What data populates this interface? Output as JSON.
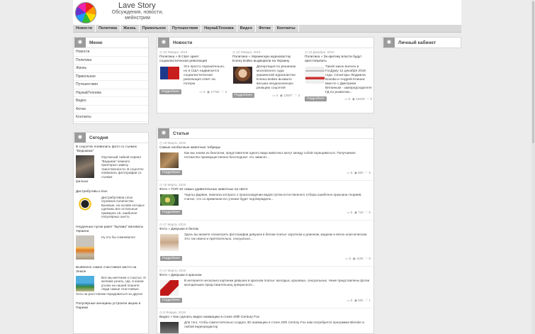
{
  "site": {
    "title": "Lave Story",
    "subtitle": "Обсуждения, новости, мейнстрим"
  },
  "nav": [
    "Новости",
    "Политика",
    "Жизнь",
    "Прикольное",
    "Путешествия",
    "Наука&Техника",
    "Видео",
    "Фотки",
    "Контакты"
  ],
  "menu": {
    "title": "Меню",
    "items": [
      "Новости",
      "Политика",
      "Жизнь",
      "Прикольное",
      "Путешествия",
      "Наука&Техника",
      "Видео",
      "Фотки",
      "Контакты"
    ]
  },
  "today": {
    "title": "Сегодня",
    "items": [
      {
        "title": "В соцсетях появились фото со съемок \"Ведьмака\"",
        "text": "Окутанный тайной сериал \"Ведьмак\" немного приоткрыл завесу таинственности. В соцсетях появились фотографии со съемок",
        "tail": "фильма"
      },
      {
        "title": "Дистрибутивы Linux",
        "text": "Дистрибутивов Linux огромное количество. Базовые, на основе которых сделаны все остальные примерно 15, наиболее популярных шесть",
        "tail": ""
      },
      {
        "title": "Неудачные пуски ракет \"Булава\" виноваты Украина",
        "text": "Ну кто бы сомневался",
        "tail": ""
      },
      {
        "title": "Выявлено самое счастливое место на Земле",
        "text": "Все мы мечтаем о счастье. И желаем узнать, где, в каком уголке на нашей планете люди самые счастливые.",
        "tail": "Хоть на расстоянии порадоваться за других"
      },
      {
        "title": "Популярные женщины устроили акцию в Париже",
        "text": "",
        "tail": ""
      }
    ]
  },
  "news": {
    "title": "Новости",
    "items": [
      {
        "date": "23 Января, 2019",
        "title": "Политика » В США зреет социалистическая революция",
        "text": "Это просто поразительно, но в США надвигается социалистическая революция ответ на потерю",
        "button": "Подробнее",
        "comments": "3",
        "views": "17752",
        "likes": "3"
      },
      {
        "date": "10 Января, 2019",
        "title": "Политика » Украинскую журналистку Елену Бойко выдворили на Украину",
        "text": "Депортация по решению московского суда украинской журналистки Елены Бойко вызвало весьма неоднозначную реакцию соцсетей",
        "button": "Подробнее",
        "comments": "4",
        "views": "12807",
        "likes": "3"
      },
      {
        "date": "24 Декабря, 2018",
        "title": "Политика » За критику власти будут арестовывать",
        "text": "Такой закон внесен в ГосДуму 12 декабря 2018 года. Сенаторы Людмила Бокова и Андрей Клишас вместе с Дмитрием Вяткиным - зампредседателя ГД по развитию...",
        "button": "Подробнее",
        "comments": "5",
        "views": "15429",
        "likes": "0"
      }
    ]
  },
  "articles": {
    "title": "Статьи",
    "items": [
      {
        "date": "19 Марта, 2019",
        "title": "Самые необычные животные тибреды",
        "text": "Как мы знаем из биологии, представители одного вида животных могут между собой скрещиваться. Получаемое потомство преимущественно бесплодное: это зависит...",
        "button": "Подробнее",
        "comments": "5",
        "views": "800",
        "likes": "0"
      },
      {
        "date": "18 Марта, 2019",
        "title": "Фото » ТОП-10 самых удивительных животных на свете",
        "text": "Чарльз Дарвин, пиюнеза которого о происхождении видов путем естественного отбора ошибочно признана теорией, считал, что со временем его учение будет подтверждено...",
        "button": "Подробнее",
        "comments": "5",
        "views": "718",
        "likes": "0"
      },
      {
        "date": "17 Марта, 2019",
        "title": "Фото » Девушки в белом",
        "text": "Здесь вы можете посмотреть фотографии девушек в белом платье: коротком и длинном, модном и вечно классическом. Это так нежно и притягательно, сексуально...",
        "button": "Подробнее",
        "comments": "5",
        "views": "1106",
        "likes": "0"
      },
      {
        "date": "17 Марта, 2019",
        "title": "Фото » Девушки в красном",
        "text": "В интернете несколько картинки девушек в красном платье: молодых, красивых, сексуальных. Ниже представлены фотки молоденьких представительниц прекрасного...",
        "button": "Подробнее",
        "comments": "5",
        "views": "605",
        "likes": "1"
      },
      {
        "date": "9 Января, 2019",
        "title": "Видео » Как сделать видео анимацию в стиле 20th Century Fox",
        "text": "Для того, чтобы самостоятельно создать 3D анимацию в стиле 20th Century Fox нам потребуется программа Blender и любой видеоредактор",
        "button": "",
        "comments": "",
        "views": "",
        "likes": ""
      }
    ]
  },
  "cabinet": {
    "title": "Личный кабинет"
  },
  "icons": {
    "box-icon": "gear-icon",
    "date-icon": "clock-icon",
    "comments-icon": "comment-icon",
    "views-icon": "eye-icon",
    "likes-icon": "heart-icon"
  },
  "colors": {
    "background": "#ececec",
    "nav": "#d9d9d9",
    "button": "#9a9a9a",
    "header_icon": "#9b9b9b"
  }
}
